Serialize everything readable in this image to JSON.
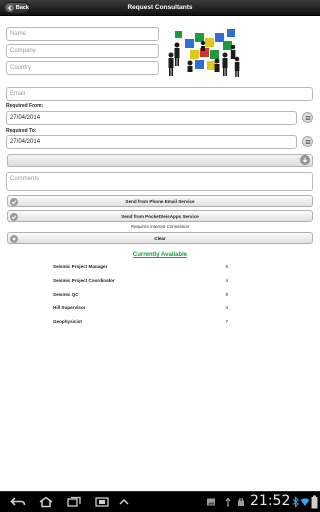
{
  "header": {
    "back_label": "Back",
    "title": "Request Consultants"
  },
  "form": {
    "name_placeholder": "Name",
    "company_placeholder": "Company",
    "country_placeholder": "Country",
    "email_placeholder": "Email",
    "required_from_label": "Required From:",
    "required_from_value": "27/04/2014",
    "required_to_label": "Required To:",
    "required_to_value": "27/04/2014",
    "comments_placeholder": "Comments"
  },
  "actions": {
    "send_phone_email": "Send from Phone Email Service",
    "send_pocketseisapps": "Send from PocketSeisApps Service",
    "requires_internet_note": "Requires Internet Connection",
    "clear": "Clear"
  },
  "available": {
    "title": "Currently Available",
    "rows": [
      {
        "name": "Seismic Project Manager",
        "count": "6"
      },
      {
        "name": "Seismic Project Coordinator",
        "count": "4"
      },
      {
        "name": "Seismic QC",
        "count": "8"
      },
      {
        "name": "Hill Supervisor",
        "count": "4"
      },
      {
        "name": "Geophysicist",
        "count": "7"
      }
    ]
  },
  "status_bar": {
    "clock": "21:52"
  },
  "icons": {
    "back": "chevron-left-icon",
    "date_picker": "list-icon",
    "dropdown": "arrow-down-circle-icon",
    "check": "check-icon",
    "close": "close-icon"
  },
  "colors": {
    "header_bg": "#1e1e1e",
    "available_title": "#11a33f",
    "system_bar": "#000000"
  }
}
